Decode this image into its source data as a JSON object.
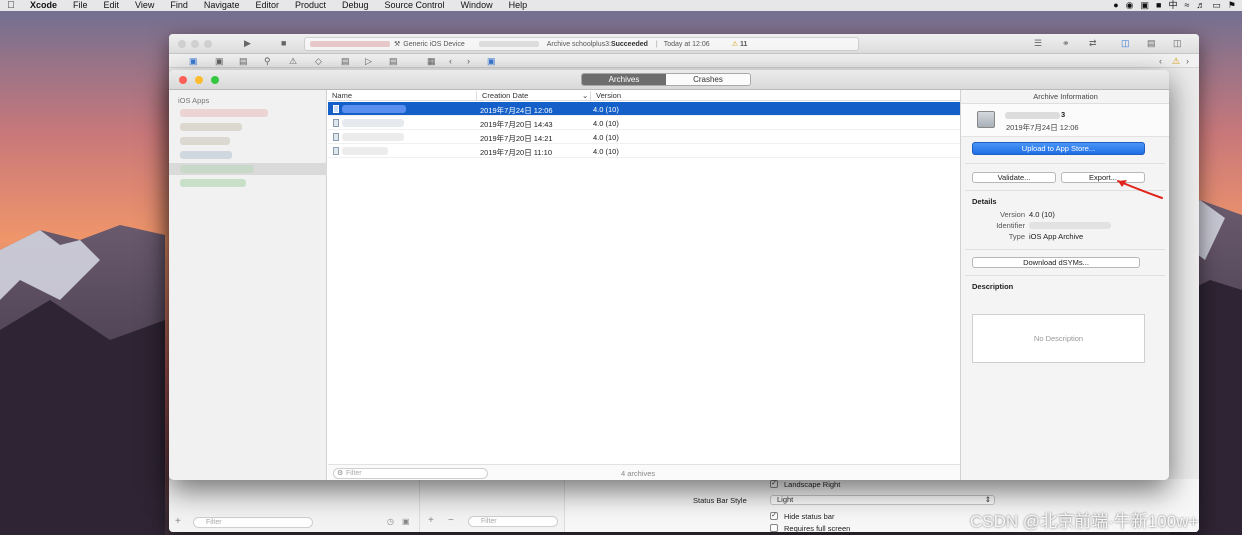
{
  "menubar": {
    "app": "Xcode",
    "items": [
      "File",
      "Edit",
      "View",
      "Find",
      "Navigate",
      "Editor",
      "Product",
      "Debug",
      "Source Control",
      "Window",
      "Help"
    ]
  },
  "xcode": {
    "scheme_device": "Generic iOS Device",
    "activity_text": "Archive schoolplus3: ",
    "activity_status": "Succeeded",
    "activity_time": "Today at 12:06",
    "warning_count": "11",
    "bottom": {
      "filter_placeholder": "Filter",
      "landscape_right": "Landscape Right",
      "status_bar_style_label": "Status Bar Style",
      "status_bar_style_value": "Light",
      "hide_status_bar": "Hide status bar",
      "requires_full_screen": "Requires full screen"
    }
  },
  "organizer": {
    "tabs": {
      "archives": "Archives",
      "crashes": "Crashes"
    },
    "sidebar": {
      "header": "iOS Apps"
    },
    "list": {
      "columns": {
        "name": "Name",
        "creation_date": "Creation Date",
        "version": "Version"
      },
      "rows": [
        {
          "date": "2019年7月24日 12:06",
          "version": "4.0 (10)",
          "selected": true
        },
        {
          "date": "2019年7月20日 14:43",
          "version": "4.0 (10)",
          "selected": false
        },
        {
          "date": "2019年7月20日 14:21",
          "version": "4.0 (10)",
          "selected": false
        },
        {
          "date": "2019年7月20日 11:10",
          "version": "4.0 (10)",
          "selected": false
        }
      ],
      "filter_placeholder": "Filter",
      "archive_count": "4 archives"
    },
    "inspector": {
      "title": "Archive Information",
      "archive_name_suffix": "3",
      "archive_date": "2019年7月24日 12:06",
      "upload_button": "Upload to App Store...",
      "validate_button": "Validate...",
      "export_button": "Export...",
      "details_title": "Details",
      "version_key": "Version",
      "version_value": "4.0 (10)",
      "identifier_key": "Identifier",
      "type_key": "Type",
      "type_value": "iOS App Archive",
      "download_dsyms_button": "Download dSYMs...",
      "description_title": "Description",
      "description_placeholder": "No Description"
    }
  },
  "watermark": "CSDN @北京前端·牛新100w+",
  "colors": {
    "selection": "#1560c8",
    "primary_button": "#2b7cf0",
    "annotation_arrow": "#e0231b"
  }
}
